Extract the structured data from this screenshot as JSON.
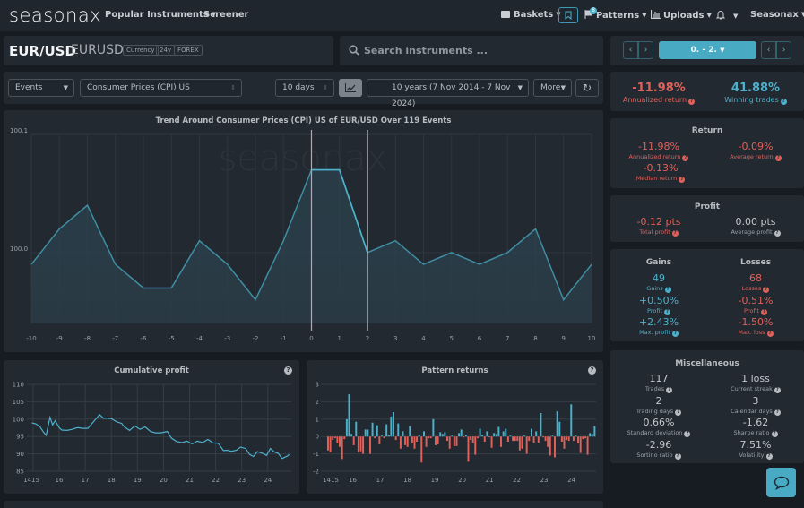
{
  "nav": {
    "logo": "seasonax",
    "popular_instruments": "Popular Instruments",
    "screener": "Screener",
    "baskets": "Baskets",
    "patterns": "Patterns",
    "patterns_badge": "8",
    "uploads": "Uploads",
    "account": "Seasonax"
  },
  "instrument": {
    "name": "EUR/USD",
    "symbol": "EURUSD",
    "tags": [
      "Currency",
      "24y",
      "FOREX"
    ]
  },
  "search": {
    "placeholder": "Search instruments ..."
  },
  "range_selector": {
    "label": "0. - 2."
  },
  "controls": {
    "mode": "Events",
    "event": "Consumer Prices (CPI) US",
    "window": "10 days",
    "period": "10 years (7 Nov 2014 - 7 Nov 2024)",
    "more": "More"
  },
  "summary": {
    "annualized_return": {
      "value": "-11.98%",
      "label": "Annualized return"
    },
    "winning_trades": {
      "value": "41.88%",
      "label": "Winning trades"
    }
  },
  "return_panel": {
    "title": "Return",
    "items": [
      {
        "value": "-11.98%",
        "label": "Annualized return"
      },
      {
        "value": "-0.09%",
        "label": "Average return"
      },
      {
        "value": "-0.13%",
        "label": "Median return"
      }
    ]
  },
  "profit_panel": {
    "title": "Profit",
    "items": [
      {
        "value": "-0.12 pts",
        "label": "Total profit"
      },
      {
        "value": "0.00 pts",
        "label": "Average profit"
      }
    ]
  },
  "gains_losses": {
    "gains_title": "Gains",
    "losses_title": "Losses",
    "gains": [
      {
        "value": "49",
        "label": "Gains"
      },
      {
        "value": "+0.50%",
        "label": "Profit"
      },
      {
        "value": "+2.43%",
        "label": "Max. profit"
      }
    ],
    "losses": [
      {
        "value": "68",
        "label": "Losses"
      },
      {
        "value": "-0.51%",
        "label": "Profit"
      },
      {
        "value": "-1.50%",
        "label": "Max. loss"
      }
    ]
  },
  "misc": {
    "title": "Miscellaneous",
    "items": [
      {
        "value": "117",
        "label": "Trades"
      },
      {
        "value": "1 loss",
        "label": "Current streak"
      },
      {
        "value": "2",
        "label": "Trading days"
      },
      {
        "value": "3",
        "label": "Calendar days"
      },
      {
        "value": "0.66%",
        "label": "Standard deviation"
      },
      {
        "value": "-1.62",
        "label": "Sharpe ratio"
      },
      {
        "value": "-2.96",
        "label": "Sortino ratio"
      },
      {
        "value": "7.51%",
        "label": "Volatility"
      }
    ]
  },
  "colors": {
    "accent": "#48aac3",
    "line": "#3f8ea3",
    "positive": "#4db1cc",
    "negative": "#e0615a",
    "start_marker": "#e48fb0",
    "end_marker": "#c9ced4"
  },
  "chart_data": [
    {
      "type": "area",
      "title": "Trend Around Consumer Prices (CPI) US of EUR/USD Over 119 Events",
      "watermark": "seasonax",
      "x": [
        -10,
        -9,
        -8,
        -7,
        -6,
        -5,
        -4,
        -3,
        -2,
        -1,
        0,
        1,
        2,
        3,
        4,
        5,
        6,
        7,
        8,
        9,
        10
      ],
      "values": [
        99.99,
        100.02,
        100.04,
        99.99,
        99.97,
        99.97,
        100.01,
        99.99,
        99.96,
        100.01,
        100.07,
        100.07,
        100.0,
        100.01,
        99.99,
        100.0,
        99.99,
        100.0,
        100.02,
        99.96,
        99.99
      ],
      "y_ticks": [
        "100.0",
        "100.1"
      ],
      "y_tick_values": [
        100.0,
        100.1
      ],
      "ylim": [
        99.94,
        100.1
      ],
      "xlim": [
        -10,
        10
      ],
      "markers": [
        {
          "x": 0,
          "label": "start"
        },
        {
          "x": 2,
          "label": "end"
        }
      ],
      "grid": true
    },
    {
      "type": "line",
      "title": "Cumulative profit",
      "x_ticks": [
        "14",
        "15",
        "16",
        "17",
        "18",
        "19",
        "20",
        "21",
        "22",
        "23",
        "24"
      ],
      "y_ticks": [
        85,
        90,
        95,
        100,
        105,
        110
      ],
      "ylim": [
        84,
        110
      ],
      "xlim": [
        14.9,
        24.8
      ],
      "points": [
        [
          14.95,
          99.2
        ],
        [
          15.1,
          98.4
        ],
        [
          15.25,
          98.2
        ],
        [
          15.4,
          96.0
        ],
        [
          15.5,
          95.6
        ],
        [
          15.65,
          100.3
        ],
        [
          15.75,
          98.6
        ],
        [
          15.85,
          99.3
        ],
        [
          16.0,
          97.8
        ],
        [
          16.1,
          96.6
        ],
        [
          16.3,
          97.0
        ],
        [
          16.5,
          96.8
        ],
        [
          16.7,
          97.8
        ],
        [
          16.9,
          97.1
        ],
        [
          17.1,
          97.6
        ],
        [
          17.25,
          98.4
        ],
        [
          17.4,
          100.2
        ],
        [
          17.55,
          101.0
        ],
        [
          17.7,
          100.5
        ],
        [
          17.85,
          100.0
        ],
        [
          18.0,
          100.4
        ],
        [
          18.2,
          99.0
        ],
        [
          18.4,
          99.0
        ],
        [
          18.5,
          97.5
        ],
        [
          18.7,
          97.0
        ],
        [
          18.9,
          97.8
        ],
        [
          19.1,
          97.3
        ],
        [
          19.3,
          97.5
        ],
        [
          19.5,
          96.7
        ],
        [
          19.7,
          95.8
        ],
        [
          19.9,
          96.3
        ],
        [
          20.15,
          96.2
        ],
        [
          20.3,
          94.8
        ],
        [
          20.5,
          93.3
        ],
        [
          20.7,
          93.5
        ],
        [
          20.9,
          93.4
        ],
        [
          21.1,
          93.1
        ],
        [
          21.3,
          93.4
        ],
        [
          21.5,
          93.5
        ],
        [
          21.7,
          93.9
        ],
        [
          21.9,
          93.4
        ],
        [
          22.1,
          92.8
        ],
        [
          22.3,
          91.2
        ],
        [
          22.45,
          90.8
        ],
        [
          22.6,
          91.0
        ],
        [
          22.8,
          90.8
        ],
        [
          22.95,
          92.2
        ],
        [
          23.15,
          91.3
        ],
        [
          23.3,
          90.1
        ],
        [
          23.45,
          89.0
        ],
        [
          23.6,
          90.9
        ],
        [
          23.8,
          89.9
        ],
        [
          23.95,
          89.8
        ],
        [
          24.1,
          91.3
        ],
        [
          24.25,
          90.8
        ],
        [
          24.4,
          89.9
        ],
        [
          24.55,
          88.9
        ],
        [
          24.65,
          88.8
        ],
        [
          24.75,
          89.6
        ],
        [
          24.82,
          89.6
        ]
      ],
      "grid": true
    },
    {
      "type": "bar",
      "title": "Pattern returns",
      "x_ticks": [
        "14",
        "15",
        "16",
        "17",
        "18",
        "19",
        "20",
        "21",
        "22",
        "23",
        "24"
      ],
      "y_ticks": [
        -2,
        -1,
        0,
        1,
        2,
        3
      ],
      "ylim": [
        -2.2,
        3.1
      ],
      "xlim": [
        14.9,
        24.8
      ],
      "values": [
        -0.8,
        -0.9,
        -0.2,
        -0.1,
        -0.4,
        -0.6,
        -1.3,
        -0.15,
        1.0,
        2.43,
        0.15,
        -0.5,
        0.85,
        -0.9,
        -0.85,
        -1.0,
        0.4,
        0.4,
        -1.0,
        0.8,
        -0.1,
        0.65,
        -0.45,
        0.05,
        -0.1,
        0.7,
        0.1,
        1.15,
        1.4,
        -0.2,
        0.75,
        -0.7,
        0.3,
        -0.5,
        -0.6,
        0.6,
        -0.4,
        -0.7,
        -0.3,
        0.1,
        -1.5,
        0.3,
        -0.6,
        -0.1,
        -0.1,
        1.0,
        -0.5,
        -0.45,
        0.25,
        0.15,
        0.25,
        -0.25,
        -0.7,
        0.05,
        -0.55,
        -0.55,
        0.2,
        0.4,
        -0.05,
        0.1,
        -1.45,
        -0.2,
        -0.4,
        -1.05,
        -0.1,
        0.45,
        0.1,
        -0.3,
        0.3,
        -0.05,
        -0.65,
        0.2,
        0.15,
        0.55,
        -0.6,
        0.3,
        0.45,
        -0.3,
        0.05,
        -0.25,
        -0.25,
        -0.25,
        -0.8,
        -0.7,
        0.05,
        -1.0,
        -0.25,
        0.45,
        -0.35,
        0.3,
        -0.35,
        1.35,
        -0.05,
        -0.25,
        -0.6,
        -1.1,
        0.05,
        -1.2,
        1.45,
        0.85,
        -0.3,
        -0.7,
        -0.2,
        -0.25,
        1.85,
        -0.25,
        0.05,
        -0.4,
        -0.95,
        -0.15,
        -0.1,
        -1.05,
        0.2,
        0.15,
        0.6
      ],
      "grid": true
    }
  ]
}
